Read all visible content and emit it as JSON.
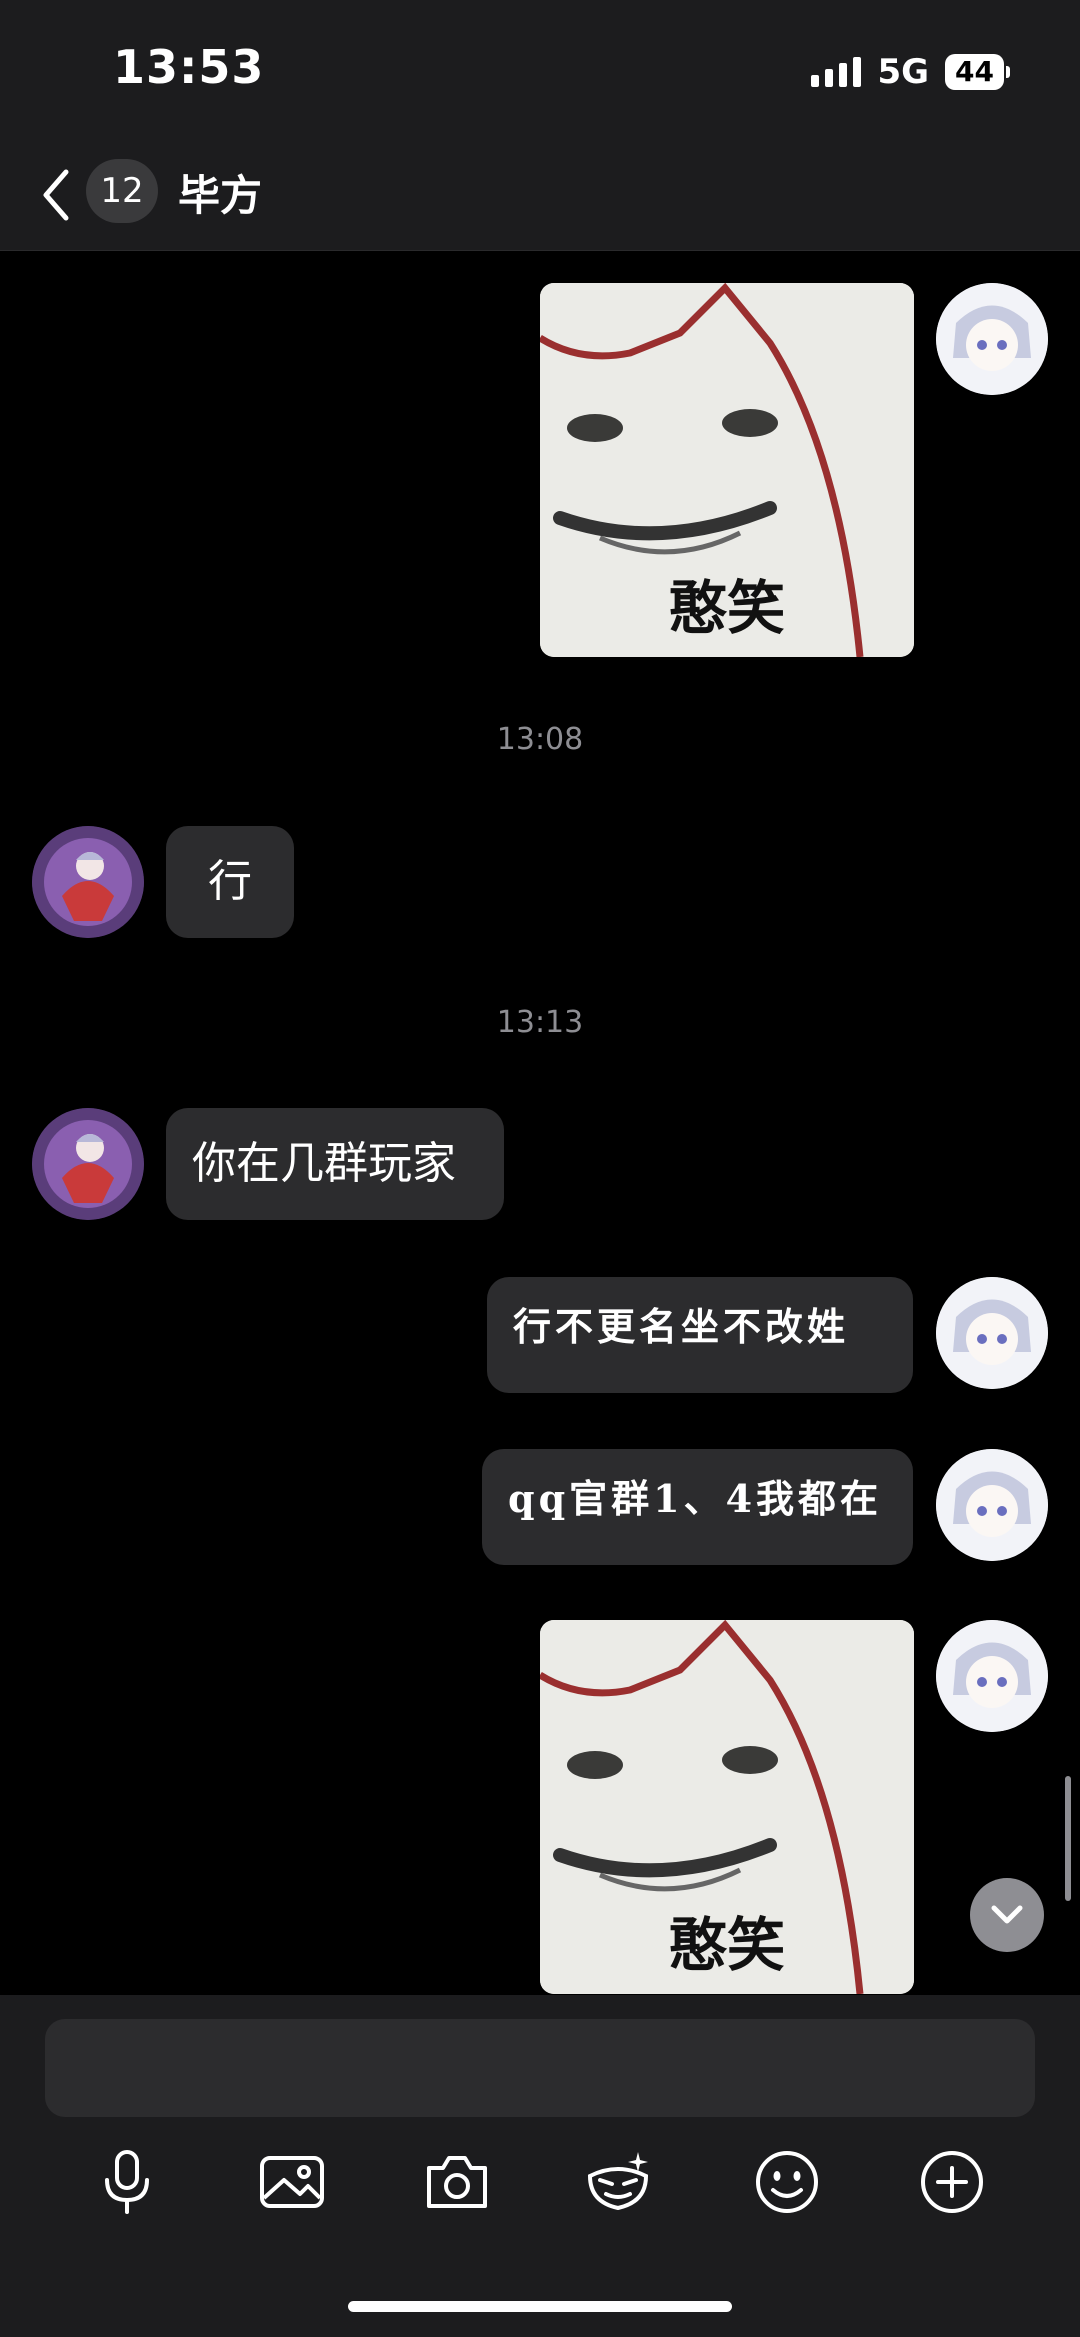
{
  "status_bar": {
    "time": "13:53",
    "network": "5G",
    "battery": "44"
  },
  "header": {
    "unread_count": "12",
    "contact_name": "毕方"
  },
  "messages": [
    {
      "type": "sticker",
      "sender": "self",
      "caption": "憨笑"
    },
    {
      "type": "timestamp",
      "text": "13:08"
    },
    {
      "type": "text",
      "sender": "other",
      "text": "行"
    },
    {
      "type": "timestamp",
      "text": "13:13"
    },
    {
      "type": "text",
      "sender": "other",
      "text": "你在几群玩家"
    },
    {
      "type": "text",
      "sender": "self",
      "text": "行不更名坐不改姓"
    },
    {
      "type": "text",
      "sender": "self",
      "text": "qq官群1、4我都在"
    },
    {
      "type": "sticker",
      "sender": "self",
      "caption": "憨笑"
    }
  ],
  "toolbar": {
    "icons": [
      "microphone-icon",
      "image-icon",
      "camera-icon",
      "sticker-icon",
      "emoji-icon",
      "plus-icon"
    ]
  },
  "colors": {
    "background": "#000000",
    "bar": "#1c1c1e",
    "bubble": "#2c2c2e",
    "secondary_text": "#8e8e93"
  }
}
